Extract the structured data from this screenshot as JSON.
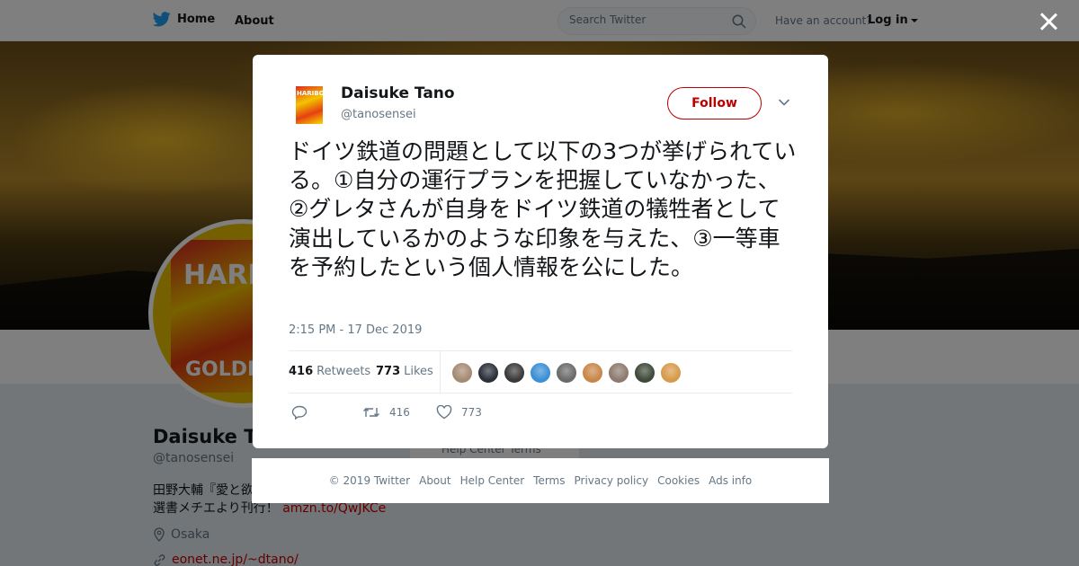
{
  "topbar": {
    "home_label": "Home",
    "about_label": "About",
    "search_placeholder": "Search Twitter",
    "have_account": "Have an account?",
    "login_label": "Log in"
  },
  "profile": {
    "name": "Daisuke Tano",
    "handle": "@tanosensei",
    "bio_line1": "田野大輔『愛と欲",
    "bio_line2": "選書メチエより刊行！",
    "bio_link": "amzn.to/QwJKCe",
    "location": "Osaka",
    "website": "eonet.ne.jp/~dtano/",
    "help_snippet": "Help Center   Terms",
    "avatar_text_top": "HARI",
    "avatar_text_bottom": "GOLDB"
  },
  "tweet": {
    "author_name": "Daisuke Tano",
    "author_handle": "@tanosensei",
    "avatar_text": "HARIBO",
    "follow_label": "Follow",
    "text": "ドイツ鉄道の問題として以下の3つが挙げられている。①自分の運行プランを把握していなかった、②グレタさんが自身をドイツ鉄道の犠牲者として演出しているかのような印象を与えた、③一等車を予約したという個人情報を公にした。",
    "timestamp": "2:15 PM - 17 Dec 2019",
    "retweets_count": "416",
    "retweets_label": "Retweets",
    "likes_count": "773",
    "likes_label": "Likes",
    "retweet_action_count": "416",
    "like_action_count": "773",
    "liker_faces": [
      "#a58a72",
      "#2b2f3a",
      "#3a3a3a",
      "#3a8fd6",
      "#6a6a6a",
      "#c8874a",
      "#8c7a6e",
      "#3f4a3a",
      "#d79a4a"
    ]
  },
  "footer": {
    "links": [
      "© 2019 Twitter",
      "About",
      "Help Center",
      "Terms",
      "Privacy policy",
      "Cookies",
      "Ads info"
    ]
  },
  "colors": {
    "accent": "#1da1f2",
    "follow_border": "#bb0000",
    "link_red": "#cc0000",
    "muted": "#657786"
  }
}
